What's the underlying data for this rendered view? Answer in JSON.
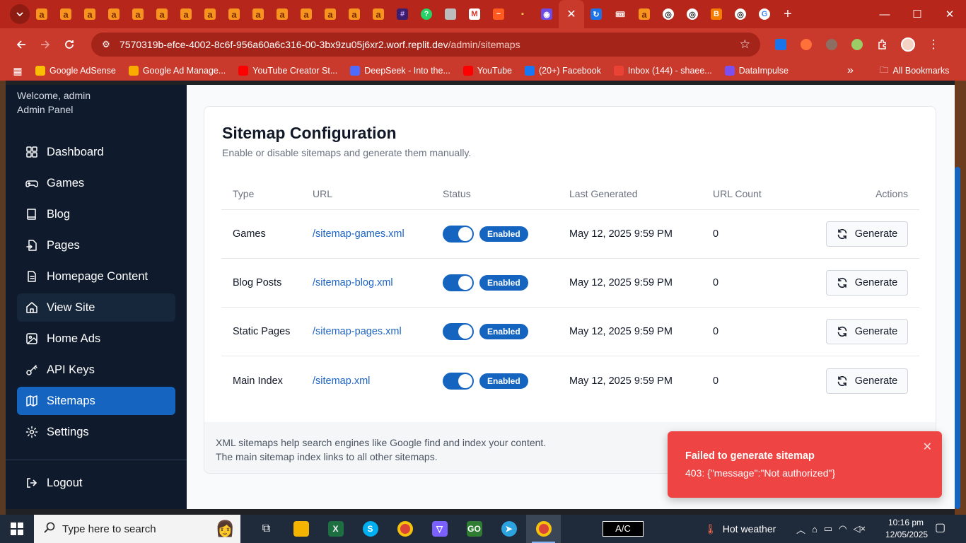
{
  "browser": {
    "address_host": "7570319b-efce-4002-8c6f-956a60a6c316-00-3bx9zu05j6xr2.worf.replit.dev",
    "address_path": "/admin/sitemaps",
    "bookmarks": [
      {
        "label": "Google AdSense",
        "color": "#fbbc04"
      },
      {
        "label": "Google Ad Manage...",
        "color": "#f9ab00"
      },
      {
        "label": "YouTube Creator St...",
        "color": "#ff0000"
      },
      {
        "label": "DeepSeek - Into the...",
        "color": "#4d6bfe"
      },
      {
        "label": "YouTube",
        "color": "#ff0000"
      },
      {
        "label": "(20+) Facebook",
        "color": "#1877f2"
      },
      {
        "label": "Inbox (144) - shaee...",
        "color": "#ea4335"
      },
      {
        "label": "DataImpulse",
        "color": "#7b4ff0"
      }
    ],
    "all_bookmarks": "All Bookmarks",
    "more_bookmarks": "»"
  },
  "sidebar": {
    "welcome": "Welcome, admin",
    "panel": "Admin Panel",
    "items": [
      {
        "label": "Dashboard",
        "icon": "dashboard-icon"
      },
      {
        "label": "Games",
        "icon": "gamepad-icon"
      },
      {
        "label": "Blog",
        "icon": "book-icon"
      },
      {
        "label": "Pages",
        "icon": "file-import-icon"
      },
      {
        "label": "Homepage Content",
        "icon": "document-icon"
      },
      {
        "label": "View Site",
        "icon": "home-icon"
      },
      {
        "label": "Home Ads",
        "icon": "image-icon"
      },
      {
        "label": "API Keys",
        "icon": "key-icon"
      },
      {
        "label": "Sitemaps",
        "icon": "map-icon"
      },
      {
        "label": "Settings",
        "icon": "gear-icon"
      }
    ],
    "logout": "Logout"
  },
  "main": {
    "title": "Sitemap Configuration",
    "subtitle": "Enable or disable sitemaps and generate them manually.",
    "columns": [
      "Type",
      "URL",
      "Status",
      "Last Generated",
      "URL Count",
      "Actions"
    ],
    "rows": [
      {
        "type": "Games",
        "url": "/sitemap-games.xml",
        "status": "Enabled",
        "last": "May 12, 2025 9:59 PM",
        "count": "0",
        "action": "Generate"
      },
      {
        "type": "Blog Posts",
        "url": "/sitemap-blog.xml",
        "status": "Enabled",
        "last": "May 12, 2025 9:59 PM",
        "count": "0",
        "action": "Generate"
      },
      {
        "type": "Static Pages",
        "url": "/sitemap-pages.xml",
        "status": "Enabled",
        "last": "May 12, 2025 9:59 PM",
        "count": "0",
        "action": "Generate"
      },
      {
        "type": "Main Index",
        "url": "/sitemap.xml",
        "status": "Enabled",
        "last": "May 12, 2025 9:59 PM",
        "count": "0",
        "action": "Generate"
      }
    ],
    "footer_line1": "XML sitemaps help search engines like Google find and index your content.",
    "footer_line2": "The main sitemap index links to all other sitemaps."
  },
  "toast": {
    "title": "Failed to generate sitemap",
    "message": "403: {\"message\":\"Not authorized\"}"
  },
  "taskbar": {
    "search_placeholder": "Type here to search",
    "ac_label": "A/C",
    "weather": "Hot weather",
    "time": "10:16 pm",
    "date": "12/05/2025"
  },
  "colors": {
    "accent": "#1565c0",
    "sidebar": "#0f1b2d",
    "toast": "#ef4444",
    "chrome": "#c9392c"
  }
}
